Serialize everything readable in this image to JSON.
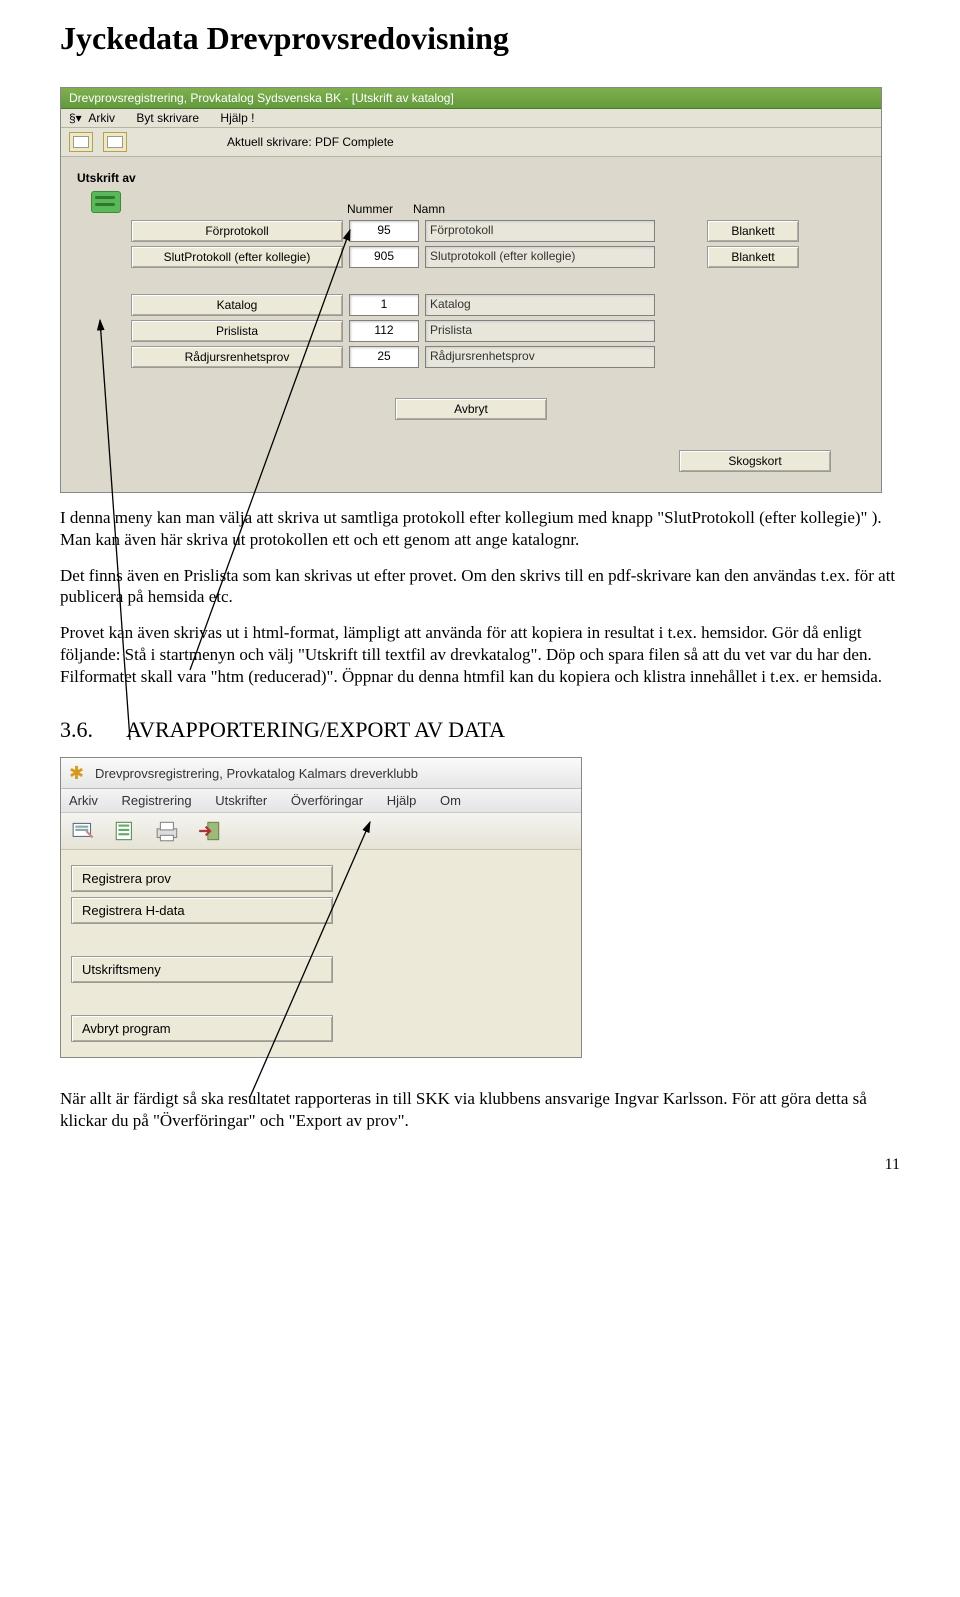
{
  "doc": {
    "title": "Jyckedata Drevprovsredovisning",
    "page_number": "11"
  },
  "app1": {
    "window_title": "Drevprovsregistrering, Provkatalog   Sydsvenska BK - [Utskrift av katalog]",
    "menu": {
      "arkiv": "Arkiv",
      "byt": "Byt skrivare",
      "hjalp": "Hjälp !"
    },
    "printer_label": "Aktuell skrivare: PDF Complete",
    "section_label": "Utskrift av",
    "headers": {
      "nummer": "Nummer",
      "namn": "Namn"
    },
    "rows": [
      {
        "btn": "Förprotokoll",
        "num": "95",
        "name": "Förprotokoll",
        "blank": "Blankett"
      },
      {
        "btn": "SlutProtokoll (efter kollegie)",
        "num": "905",
        "name": "Slutprotokoll (efter kollegie)",
        "blank": "Blankett"
      },
      {
        "btn": "Katalog",
        "num": "1",
        "name": "Katalog",
        "blank": ""
      },
      {
        "btn": "Prislista",
        "num": "112",
        "name": "Prislista",
        "blank": ""
      },
      {
        "btn": "Rådjursrenhetsprov",
        "num": "25",
        "name": "Rådjursrenhetsprov",
        "blank": ""
      }
    ],
    "avbryt": "Avbryt",
    "skogskort": "Skogskort"
  },
  "text": {
    "p1": "I denna meny kan man välja att skriva ut samtliga protokoll efter kollegium med knapp \"SlutProtokoll (efter kollegie)\" ). Man kan även här skriva ut protokollen ett och ett genom att ange katalognr.",
    "p2": "Det finns även en Prislista som kan skrivas ut efter provet. Om den skrivs till en pdf-skrivare kan den användas t.ex. för att publicera på hemsida etc.",
    "p3": "Provet kan även skrivas ut i html-format, lämpligt att använda för att kopiera in resultat i t.ex. hemsidor. Gör då enligt följande: Stå i startmenyn och välj \"Utskrift till textfil av drevkatalog\". Döp och spara filen så att du vet var du har den. Filformatet skall vara \"htm (reducerad)\". Öppnar du denna htmfil kan du kopiera och klistra innehållet i t.ex. er hemsida.",
    "h2_num": "3.6.",
    "h2_label": "AVRAPPORTERING/EXPORT AV DATA",
    "p4": "När allt är färdigt så ska resultatet rapporteras in till SKK via klubbens ansvarige Ingvar Karlsson. För att göra detta så klickar du på \"Överföringar\" och \"Export av prov\"."
  },
  "app2": {
    "window_title": "Drevprovsregistrering, Provkatalog   Kalmars dreverklubb",
    "menu": {
      "arkiv": "Arkiv",
      "reg": "Registrering",
      "utskr": "Utskrifter",
      "over": "Överföringar",
      "hjalp": "Hjälp",
      "om": "Om"
    },
    "btn_reg_prov": "Registrera prov",
    "btn_reg_h": "Registrera H-data",
    "btn_utskrift": "Utskriftsmeny",
    "btn_avbryt": "Avbryt program"
  }
}
